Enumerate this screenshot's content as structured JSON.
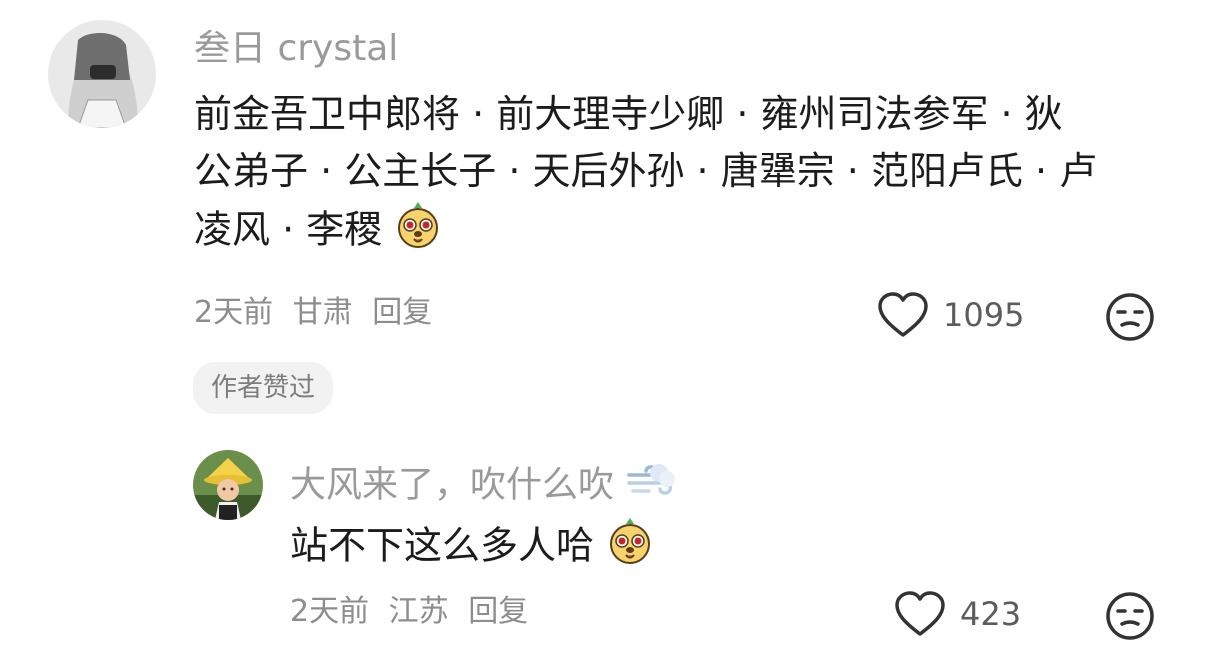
{
  "comment": {
    "username": "叁日 crystal",
    "text_lines": [
      "前金吾卫中郎将 · 前大理寺少卿 · 雍州司法参军 · 狄",
      "公弟子 · 公主长子 · 天后外孙 · 唐犟宗 · 范阳卢氏 · 卢",
      "凌风 · 李稷"
    ],
    "time": "2天前",
    "location": "甘肃",
    "reply_label": "回复",
    "like_count": "1095",
    "badge": "作者赞过"
  },
  "reply": {
    "username": "大风来了，吹什么吹",
    "text": "站不下这么多人哈",
    "time": "2天前",
    "location": "江苏",
    "reply_label": "回复",
    "like_count": "423"
  },
  "icons": {
    "like": "heart-outline-icon",
    "dislike": "unamused-face-icon",
    "emoji": "cute-dog-emoji",
    "wind": "wind-emoji"
  }
}
